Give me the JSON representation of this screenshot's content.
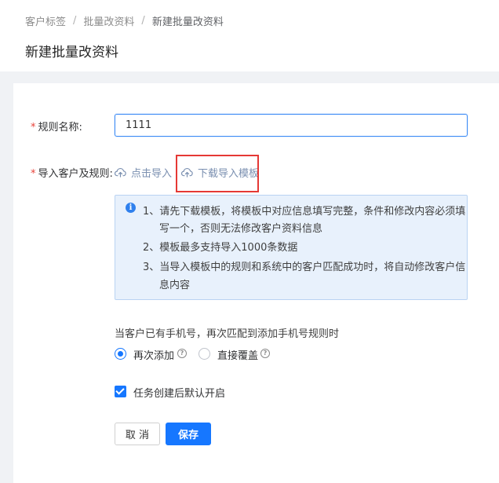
{
  "breadcrumb": {
    "items": [
      "客户标签",
      "批量改资料",
      "新建批量改资料"
    ],
    "separator": "/"
  },
  "page": {
    "title": "新建批量改资料"
  },
  "form": {
    "required_mark": "*",
    "name_label": "规则名称:",
    "name_value": "1111",
    "import_label": "导入客户及规则:",
    "import_link": "点击导入",
    "download_link": "下载导入模板",
    "info_icon": "i",
    "info_lines": [
      "1、请先下载模板，将模板中对应信息填写完整，条件和修改内容必须填",
      "写一个，否则无法修改客户资料信息",
      "2、模板最多支持导入1000条数据",
      "3、当导入模板中的规则和系统中的客户匹配成功时，将自动修改客户信",
      "息内容"
    ],
    "phone_question": "当客户已有手机号，再次匹配到添加手机号规则时",
    "radio_options": [
      {
        "label": "再次添加",
        "checked": true
      },
      {
        "label": "直接覆盖",
        "checked": false
      }
    ],
    "help_glyph": "?",
    "auto_enable_label": "任务创建后默认开启",
    "auto_enable_checked": true,
    "cancel_label": "取 消",
    "save_label": "保存"
  },
  "colors": {
    "primary": "#1677ff",
    "link": "#7a8fb0",
    "required": "#e8433a",
    "highlight": "#e53935",
    "info_bg": "#e8f1fc"
  },
  "icons": {
    "upload": "cloud-upload-icon",
    "download": "cloud-download-icon",
    "info": "info-icon",
    "help": "question-circle-icon"
  }
}
